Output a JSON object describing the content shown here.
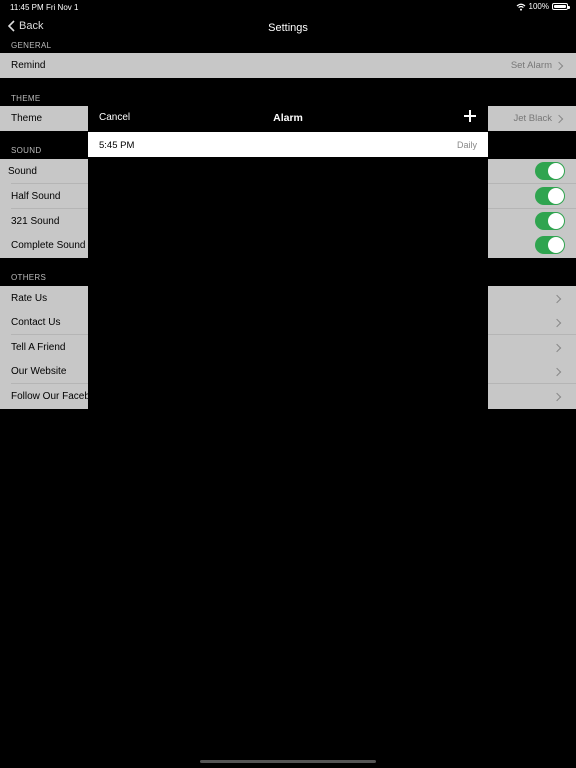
{
  "status": {
    "time": "11:45 PM",
    "date": "Fri Nov 1",
    "battery": "100%"
  },
  "nav": {
    "back_label": "Back",
    "title": "Settings"
  },
  "sections": {
    "general": "GENERAL",
    "theme": "THEME",
    "sound": "SOUND",
    "others": "OTHERS"
  },
  "rows": {
    "remind": {
      "label": "Remind",
      "value": "Set Alarm"
    },
    "theme": {
      "label": "Theme",
      "value": "Jet Black"
    },
    "sound": {
      "label": "Sound",
      "on": true
    },
    "half_sound": {
      "label": "Half Sound",
      "on": true
    },
    "sound_321": {
      "label": "321 Sound",
      "on": true
    },
    "complete_sound": {
      "label": "Complete Sound",
      "on": true
    },
    "rate_us": {
      "label": "Rate Us"
    },
    "contact_us": {
      "label": "Contact Us"
    },
    "tell_friend": {
      "label": "Tell A Friend"
    },
    "website": {
      "label": "Our Website"
    },
    "facebook": {
      "label": "Follow Our Facebo"
    }
  },
  "modal": {
    "cancel_label": "Cancel",
    "title": "Alarm",
    "add_icon": "plus-icon",
    "alarms": [
      {
        "time": "5:45 PM",
        "repeat": "Daily"
      }
    ]
  },
  "colors": {
    "toggle_on": "#2fa44f",
    "row_bg": "#c7c7c7"
  }
}
